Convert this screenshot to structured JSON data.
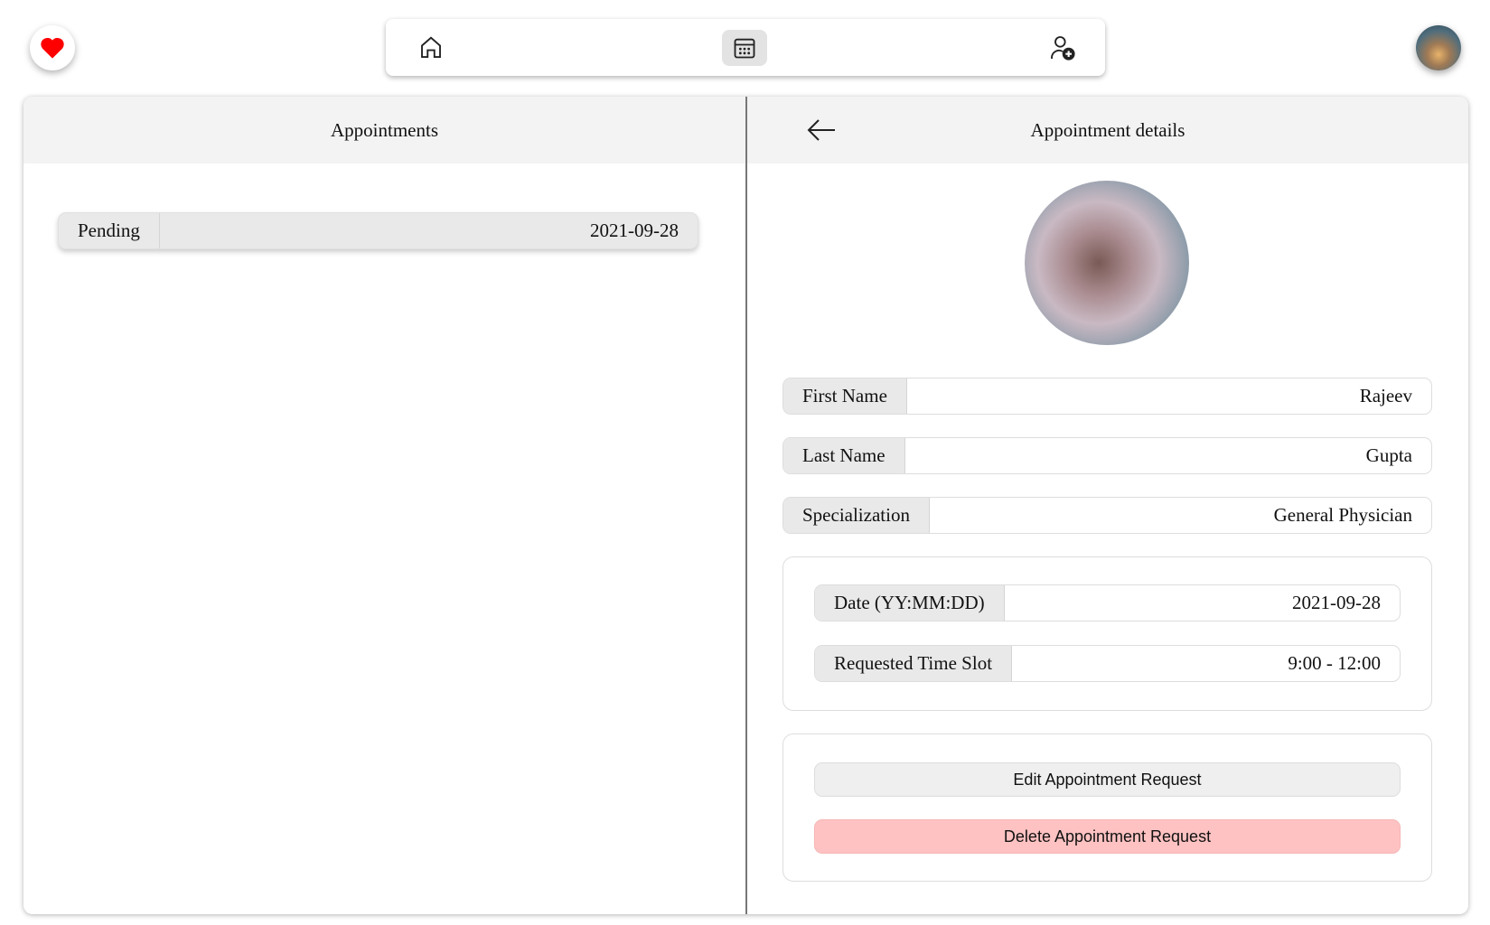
{
  "nav": {
    "icons": [
      "heart-icon",
      "home-icon",
      "calendar-icon",
      "user-add-icon",
      "avatar"
    ],
    "active": "calendar"
  },
  "appointments": {
    "title": "Appointments",
    "items": [
      {
        "status": "Pending",
        "date": "2021-09-28"
      }
    ]
  },
  "details": {
    "title": "Appointment details",
    "fields": [
      {
        "label": "First Name",
        "value": "Rajeev"
      },
      {
        "label": "Last Name",
        "value": "Gupta"
      },
      {
        "label": "Specialization",
        "value": "General Physician"
      }
    ],
    "schedule": [
      {
        "label": "Date (YY:MM:DD)",
        "value": "2021-09-28"
      },
      {
        "label": "Requested Time Slot",
        "value": "9:00 - 12:00"
      }
    ],
    "edit_label": "Edit Appointment Request",
    "delete_label": "Delete Appointment Request"
  },
  "colors": {
    "heart": "#ff0000",
    "delete": "#ffc2c2",
    "active_nav": "#e3e3e3"
  }
}
